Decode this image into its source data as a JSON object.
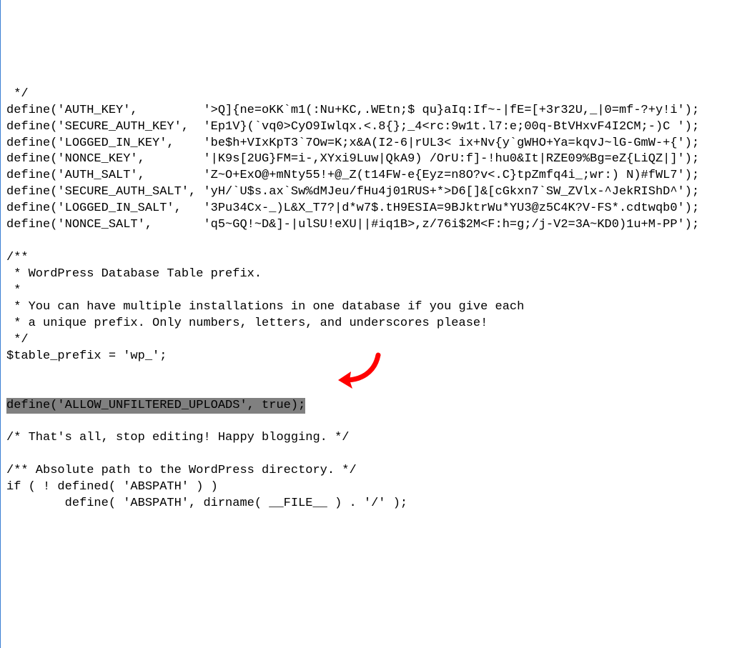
{
  "code": {
    "l01": " */",
    "l02": "define('AUTH_KEY',         '>Q]{ne=oKK`m1(:Nu+KC,.WEtn;$ qu}aIq:If~-|fE=[+3r32U,_|0=mf-?+y!i');",
    "l03": "define('SECURE_AUTH_KEY',  'Ep1V}(`vq0>CyO9Iwlqx.<.8{};_4<rc:9w1t.l7:e;00q-BtVHxvF4I2CM;-)C ');",
    "l04": "define('LOGGED_IN_KEY',    'be$h+VIxKpT3`7Ow=K;x&A(I2-6|rUL3< ix+Nv{y`gWHO+Ya=kqvJ~lG-GmW-+{');",
    "l05": "define('NONCE_KEY',        '|K9s[2UG}FM=i-,XYxi9Luw|QkA9) /OrU:f]-!hu0&It|RZE09%Bg=eZ{LiQZ|]');",
    "l06": "define('AUTH_SALT',        'Z~O+ExO@+mNty55!+@_Z(t14FW-e{Eyz=n8O?v<.C}tpZmfq4i_;wr:) N)#fWL7');",
    "l07": "define('SECURE_AUTH_SALT', 'yH/`U$s.ax`Sw%dMJeu/fHu4j01RUS+*>D6[]&[cGkxn7`SW_ZVlx-^JekRIShD^');",
    "l08": "define('LOGGED_IN_SALT',   '3Pu34Cx-_)L&X_T7?|d*w7$.tH9ESIA=9BJktrWu*YU3@z5C4K?V-FS*.cdtwqb0');",
    "l09": "define('NONCE_SALT',       'q5~GQ!~D&]-|ulSU!eXU||#iq1B>,z/76i$2M<F:h=g;/j-V2=3A~KD0)1u+M-PP');",
    "l10": "",
    "l11": "/**",
    "l12": " * WordPress Database Table prefix.",
    "l13": " *",
    "l14": " * You can have multiple installations in one database if you give each",
    "l15": " * a unique prefix. Only numbers, letters, and underscores please!",
    "l16": " */",
    "l17": "$table_prefix = 'wp_';",
    "l18": "",
    "l19": "",
    "hl": "define('ALLOW_UNFILTERED_UPLOADS', true);",
    "l20": "",
    "l21": "/* That's all, stop editing! Happy blogging. */",
    "l22": "",
    "l23": "/** Absolute path to the WordPress directory. */",
    "l24": "if ( ! defined( 'ABSPATH' ) )",
    "l25": "        define( 'ABSPATH', dirname( __FILE__ ) . '/' );"
  },
  "annotation": {
    "arrow_color": "#ff0000"
  }
}
